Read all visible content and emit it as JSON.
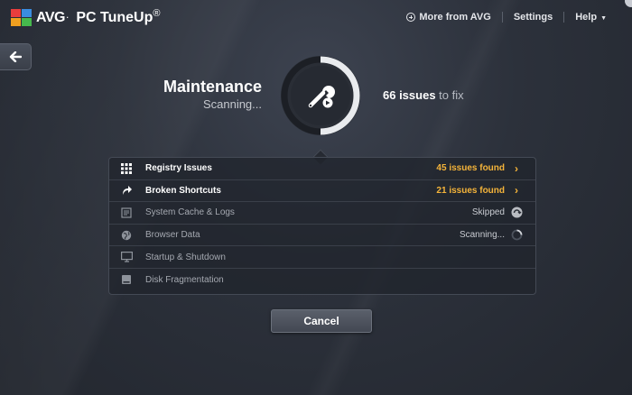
{
  "header": {
    "brand": "AVG",
    "brand_separator": ".",
    "product": "PC TuneUp",
    "registered": "®",
    "nav": {
      "more_from": "More from AVG",
      "settings": "Settings",
      "help": "Help"
    }
  },
  "status": {
    "title": "Maintenance",
    "subtitle": "Scanning...",
    "issues_count": "66 issues",
    "issues_suffix": "to fix",
    "progress": 0.5
  },
  "scan_items": [
    {
      "label": "Registry Issues",
      "status": "45 issues found",
      "state": "found",
      "icon": "registry-grid-icon"
    },
    {
      "label": "Broken Shortcuts",
      "status": "21 issues found",
      "state": "found",
      "icon": "broken-shortcut-icon"
    },
    {
      "label": "System Cache & Logs",
      "status": "Skipped",
      "state": "skipped",
      "icon": "cache-logs-icon"
    },
    {
      "label": "Browser Data",
      "status": "Scanning...",
      "state": "scanning",
      "icon": "globe-icon"
    },
    {
      "label": "Startup & Shutdown",
      "status": "",
      "state": "pending",
      "icon": "monitor-icon"
    },
    {
      "label": "Disk Fragmentation",
      "status": "",
      "state": "pending",
      "icon": "disk-icon"
    }
  ],
  "actions": {
    "cancel": "Cancel"
  },
  "colors": {
    "accent": "#f5b43a",
    "background": "#2c313b",
    "panel": "#20242c"
  }
}
